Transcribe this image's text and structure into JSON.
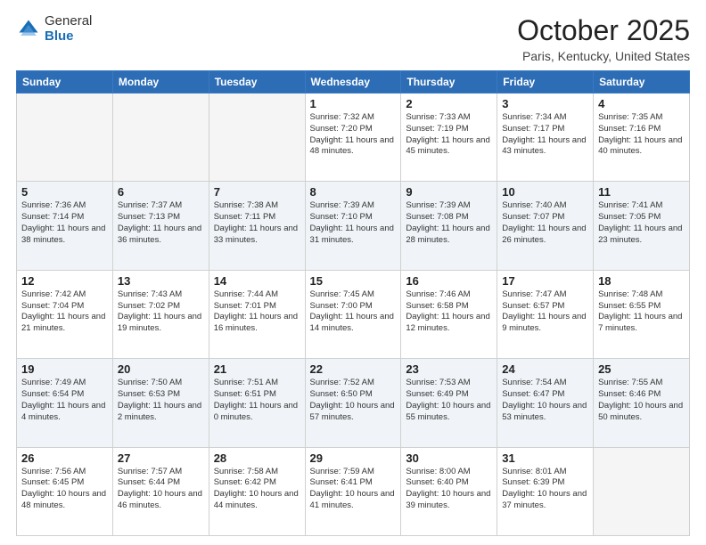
{
  "header": {
    "logo_general": "General",
    "logo_blue": "Blue",
    "month_title": "October 2025",
    "subtitle": "Paris, Kentucky, United States"
  },
  "days_of_week": [
    "Sunday",
    "Monday",
    "Tuesday",
    "Wednesday",
    "Thursday",
    "Friday",
    "Saturday"
  ],
  "weeks": [
    [
      {
        "day": "",
        "info": "",
        "empty": true
      },
      {
        "day": "",
        "info": "",
        "empty": true
      },
      {
        "day": "",
        "info": "",
        "empty": true
      },
      {
        "day": "1",
        "info": "Sunrise: 7:32 AM\nSunset: 7:20 PM\nDaylight: 11 hours\nand 48 minutes.",
        "empty": false
      },
      {
        "day": "2",
        "info": "Sunrise: 7:33 AM\nSunset: 7:19 PM\nDaylight: 11 hours\nand 45 minutes.",
        "empty": false
      },
      {
        "day": "3",
        "info": "Sunrise: 7:34 AM\nSunset: 7:17 PM\nDaylight: 11 hours\nand 43 minutes.",
        "empty": false
      },
      {
        "day": "4",
        "info": "Sunrise: 7:35 AM\nSunset: 7:16 PM\nDaylight: 11 hours\nand 40 minutes.",
        "empty": false
      }
    ],
    [
      {
        "day": "5",
        "info": "Sunrise: 7:36 AM\nSunset: 7:14 PM\nDaylight: 11 hours\nand 38 minutes.",
        "empty": false
      },
      {
        "day": "6",
        "info": "Sunrise: 7:37 AM\nSunset: 7:13 PM\nDaylight: 11 hours\nand 36 minutes.",
        "empty": false
      },
      {
        "day": "7",
        "info": "Sunrise: 7:38 AM\nSunset: 7:11 PM\nDaylight: 11 hours\nand 33 minutes.",
        "empty": false
      },
      {
        "day": "8",
        "info": "Sunrise: 7:39 AM\nSunset: 7:10 PM\nDaylight: 11 hours\nand 31 minutes.",
        "empty": false
      },
      {
        "day": "9",
        "info": "Sunrise: 7:39 AM\nSunset: 7:08 PM\nDaylight: 11 hours\nand 28 minutes.",
        "empty": false
      },
      {
        "day": "10",
        "info": "Sunrise: 7:40 AM\nSunset: 7:07 PM\nDaylight: 11 hours\nand 26 minutes.",
        "empty": false
      },
      {
        "day": "11",
        "info": "Sunrise: 7:41 AM\nSunset: 7:05 PM\nDaylight: 11 hours\nand 23 minutes.",
        "empty": false
      }
    ],
    [
      {
        "day": "12",
        "info": "Sunrise: 7:42 AM\nSunset: 7:04 PM\nDaylight: 11 hours\nand 21 minutes.",
        "empty": false
      },
      {
        "day": "13",
        "info": "Sunrise: 7:43 AM\nSunset: 7:02 PM\nDaylight: 11 hours\nand 19 minutes.",
        "empty": false
      },
      {
        "day": "14",
        "info": "Sunrise: 7:44 AM\nSunset: 7:01 PM\nDaylight: 11 hours\nand 16 minutes.",
        "empty": false
      },
      {
        "day": "15",
        "info": "Sunrise: 7:45 AM\nSunset: 7:00 PM\nDaylight: 11 hours\nand 14 minutes.",
        "empty": false
      },
      {
        "day": "16",
        "info": "Sunrise: 7:46 AM\nSunset: 6:58 PM\nDaylight: 11 hours\nand 12 minutes.",
        "empty": false
      },
      {
        "day": "17",
        "info": "Sunrise: 7:47 AM\nSunset: 6:57 PM\nDaylight: 11 hours\nand 9 minutes.",
        "empty": false
      },
      {
        "day": "18",
        "info": "Sunrise: 7:48 AM\nSunset: 6:55 PM\nDaylight: 11 hours\nand 7 minutes.",
        "empty": false
      }
    ],
    [
      {
        "day": "19",
        "info": "Sunrise: 7:49 AM\nSunset: 6:54 PM\nDaylight: 11 hours\nand 4 minutes.",
        "empty": false
      },
      {
        "day": "20",
        "info": "Sunrise: 7:50 AM\nSunset: 6:53 PM\nDaylight: 11 hours\nand 2 minutes.",
        "empty": false
      },
      {
        "day": "21",
        "info": "Sunrise: 7:51 AM\nSunset: 6:51 PM\nDaylight: 11 hours\nand 0 minutes.",
        "empty": false
      },
      {
        "day": "22",
        "info": "Sunrise: 7:52 AM\nSunset: 6:50 PM\nDaylight: 10 hours\nand 57 minutes.",
        "empty": false
      },
      {
        "day": "23",
        "info": "Sunrise: 7:53 AM\nSunset: 6:49 PM\nDaylight: 10 hours\nand 55 minutes.",
        "empty": false
      },
      {
        "day": "24",
        "info": "Sunrise: 7:54 AM\nSunset: 6:47 PM\nDaylight: 10 hours\nand 53 minutes.",
        "empty": false
      },
      {
        "day": "25",
        "info": "Sunrise: 7:55 AM\nSunset: 6:46 PM\nDaylight: 10 hours\nand 50 minutes.",
        "empty": false
      }
    ],
    [
      {
        "day": "26",
        "info": "Sunrise: 7:56 AM\nSunset: 6:45 PM\nDaylight: 10 hours\nand 48 minutes.",
        "empty": false
      },
      {
        "day": "27",
        "info": "Sunrise: 7:57 AM\nSunset: 6:44 PM\nDaylight: 10 hours\nand 46 minutes.",
        "empty": false
      },
      {
        "day": "28",
        "info": "Sunrise: 7:58 AM\nSunset: 6:42 PM\nDaylight: 10 hours\nand 44 minutes.",
        "empty": false
      },
      {
        "day": "29",
        "info": "Sunrise: 7:59 AM\nSunset: 6:41 PM\nDaylight: 10 hours\nand 41 minutes.",
        "empty": false
      },
      {
        "day": "30",
        "info": "Sunrise: 8:00 AM\nSunset: 6:40 PM\nDaylight: 10 hours\nand 39 minutes.",
        "empty": false
      },
      {
        "day": "31",
        "info": "Sunrise: 8:01 AM\nSunset: 6:39 PM\nDaylight: 10 hours\nand 37 minutes.",
        "empty": false
      },
      {
        "day": "",
        "info": "",
        "empty": true
      }
    ]
  ]
}
